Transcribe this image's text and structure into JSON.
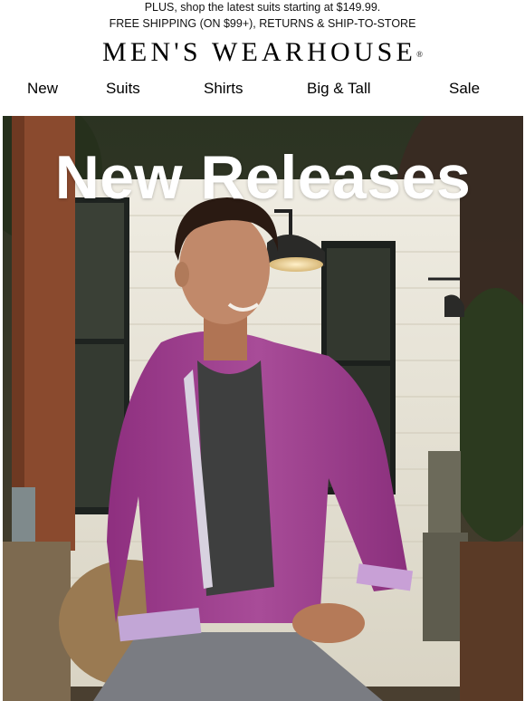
{
  "promo": {
    "line1": "PLUS, shop the latest suits starting at $149.99.",
    "line2": "FREE SHIPPING (ON $99+), RETURNS & SHIP-TO-STORE"
  },
  "brand": {
    "name": "MEN'S WEARHOUSE",
    "mark": "®"
  },
  "nav": {
    "items": [
      {
        "label": "New"
      },
      {
        "label": "Suits"
      },
      {
        "label": "Shirts"
      },
      {
        "label": "Big & Tall"
      },
      {
        "label": "Sale"
      }
    ]
  },
  "hero": {
    "title": "New Releases",
    "image_subject": "model-in-purple-shirt"
  },
  "colors": {
    "shirt": "#9c3d8c",
    "house_siding": "#e8e4d6",
    "wood_post": "#8a4a2e",
    "foliage": "#2e3a22"
  }
}
